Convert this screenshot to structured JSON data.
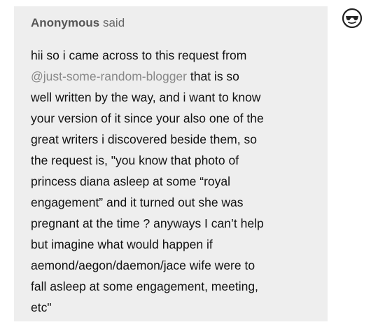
{
  "ask": {
    "asker_name": "Anonymous",
    "asker_said": "said",
    "lines": [
      "hii so i came across to this request from",
      "that is so",
      "well written by the way, and i want to know",
      "your version of it since your also one of the",
      "great writers i discovered beside them, so",
      "the request is, \"you know that photo of",
      "princess diana asleep at some “royal",
      "engagement” and it turned out she was",
      "pregnant at the time ? anyways I can’t help",
      "but imagine what would happen if",
      "aemond/aegon/daemon/jace wife were to",
      "fall asleep at some engagement, meeting,",
      "etc\""
    ],
    "mention": "@just-some-random-blogger"
  },
  "avatar": {
    "icon": "anonymous-sunglasses-face-icon"
  },
  "colors": {
    "bubble_bg": "#eeeeee",
    "text": "#111111",
    "mention": "#888888",
    "asker": "#555555"
  }
}
